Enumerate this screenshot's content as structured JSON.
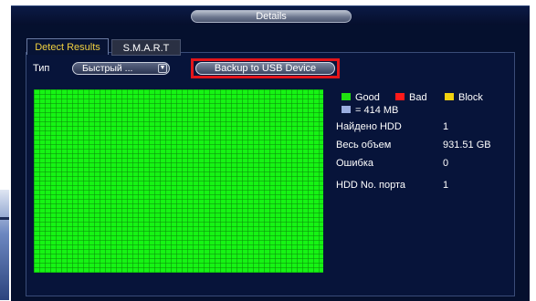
{
  "dialog": {
    "title": "Details"
  },
  "tabs": [
    {
      "label": "Detect Results",
      "active": true
    },
    {
      "label": "S.M.A.R.T",
      "active": false
    }
  ],
  "type_field": {
    "label": "Тип",
    "value": "Быстрый ..."
  },
  "backup_button": {
    "label": "Backup to USB Device"
  },
  "legend": {
    "good": {
      "label": "Good",
      "color": "#20e010"
    },
    "bad": {
      "label": "Bad",
      "color": "#ff1a1a"
    },
    "block": {
      "label": "Block",
      "color": "#f2d20f"
    },
    "block_size": {
      "label": "= 414 MB",
      "color": "#9aaee0"
    }
  },
  "info": [
    {
      "label": "Найдено HDD",
      "value": "1"
    },
    {
      "label": "Весь объем",
      "value": "931.51 GB"
    },
    {
      "label": "Ошибка",
      "value": "0"
    },
    {
      "label": "HDD No. порта",
      "value": "1"
    }
  ],
  "disk_map": {
    "status": "good",
    "color": "#16f414"
  }
}
